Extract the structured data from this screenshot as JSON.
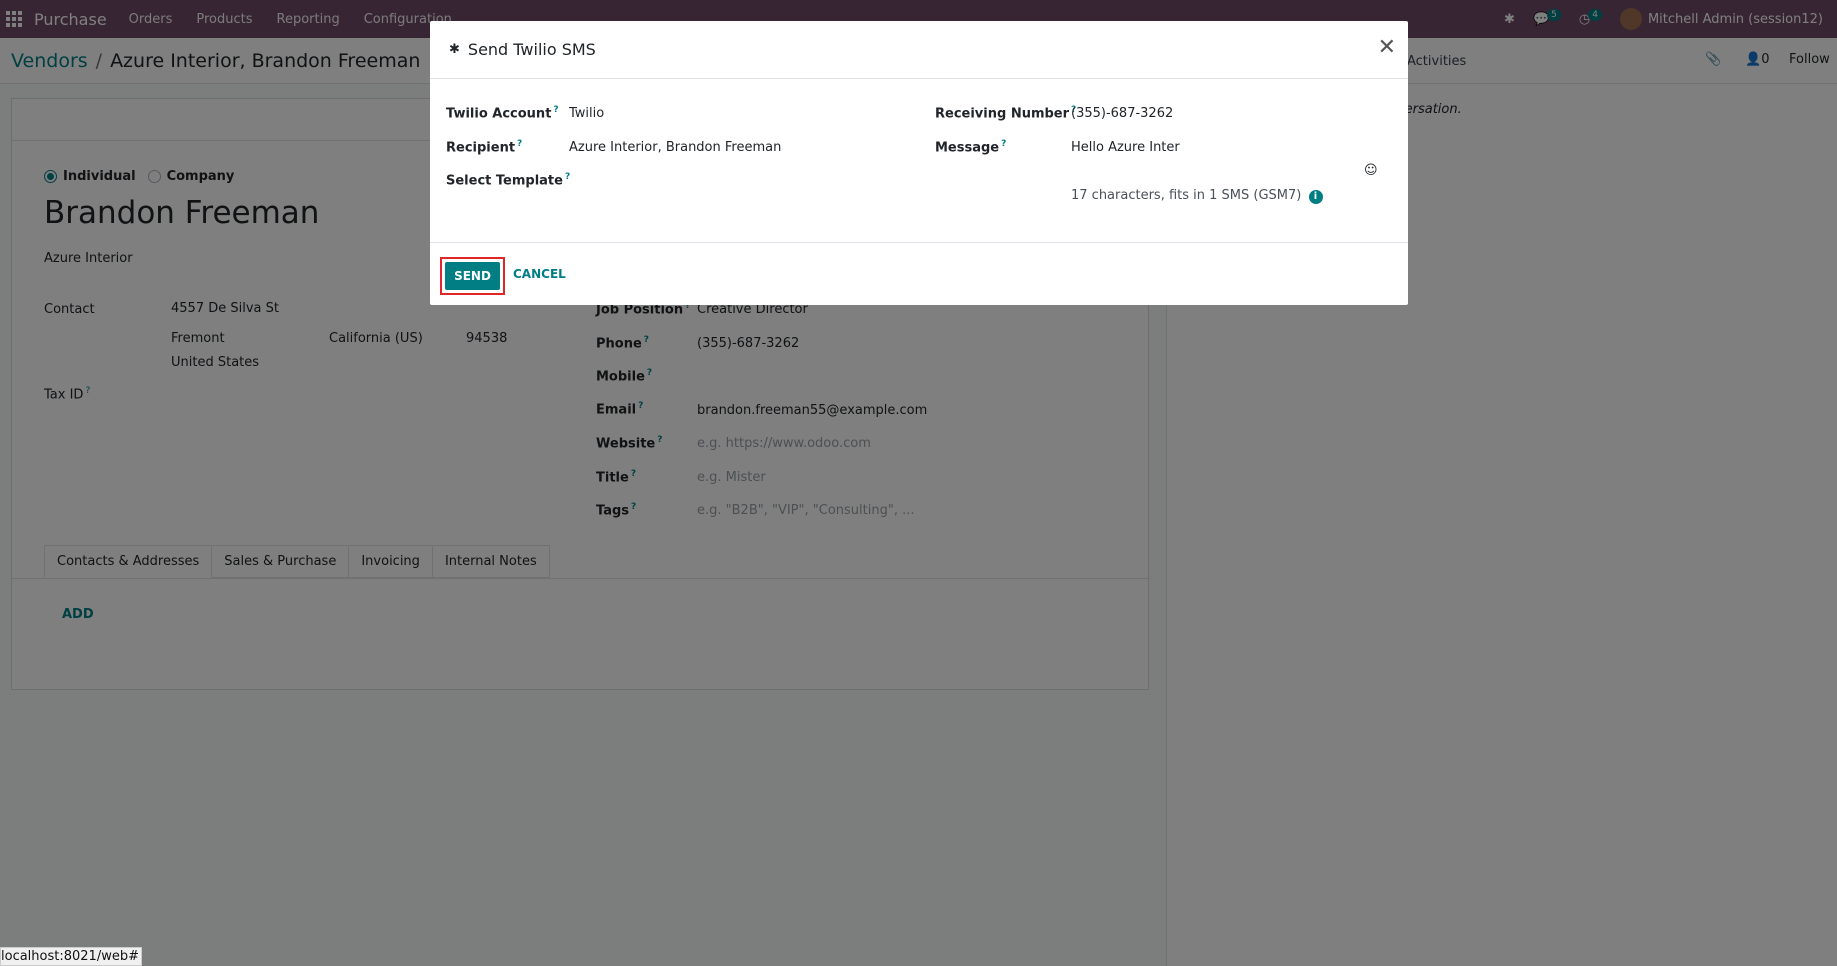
{
  "navbar": {
    "app_name": "Purchase",
    "menu": [
      "Orders",
      "Products",
      "Reporting",
      "Configuration"
    ],
    "messages_count": "5",
    "activities_count": "4",
    "user": "Mitchell Admin (session12)"
  },
  "control": {
    "breadcrumb_parent": "Vendors",
    "breadcrumb_sep": "/",
    "breadcrumb_current": "Azure Interior, Brandon Freeman",
    "chatter_activities": "Activities",
    "followers_count": "0",
    "follow_label": "Follow"
  },
  "form": {
    "type_individual": "Individual",
    "type_company": "Company",
    "name": "Brandon Freeman",
    "company": "Azure Interior",
    "contact_label": "Contact",
    "street": "4557 De Silva St",
    "city": "Fremont",
    "state": "California (US)",
    "zip": "94538",
    "country": "United States",
    "tax_id_label": "Tax ID",
    "job_position_label": "Job Position",
    "job_position": "Creative Director",
    "phone_label": "Phone",
    "phone": "(355)-687-3262",
    "mobile_label": "Mobile",
    "email_label": "Email",
    "email": "brandon.freeman55@example.com",
    "website_label": "Website",
    "website_placeholder": "e.g. https://www.odoo.com",
    "title_label": "Title",
    "title_placeholder": "e.g. Mister",
    "tags_label": "Tags",
    "tags_placeholder": "e.g. \"B2B\", \"VIP\", \"Consulting\", ...",
    "tabs": [
      "Contacts & Addresses",
      "Sales & Purchase",
      "Invoicing",
      "Internal Notes"
    ],
    "add_label": "ADD"
  },
  "chatter": {
    "empty_message": "There are no messages in this conversation."
  },
  "modal": {
    "title": "Send Twilio SMS",
    "twilio_account_label": "Twilio Account",
    "twilio_account": "Twilio",
    "recipient_label": "Recipient",
    "recipient": "Azure Interior, Brandon Freeman",
    "select_template_label": "Select Template",
    "receiving_number_label": "Receiving Number",
    "receiving_number": "(355)-687-3262",
    "message_label": "Message",
    "message": "Hello Azure Inter",
    "char_info": "17 characters, fits in 1 SMS (GSM7)",
    "send_label": "SEND",
    "cancel_label": "CANCEL"
  },
  "status_url": "localhost:8021/web#",
  "colors": {
    "brand": "#714b67",
    "accent": "#017e84",
    "highlight": "#e0262b"
  }
}
